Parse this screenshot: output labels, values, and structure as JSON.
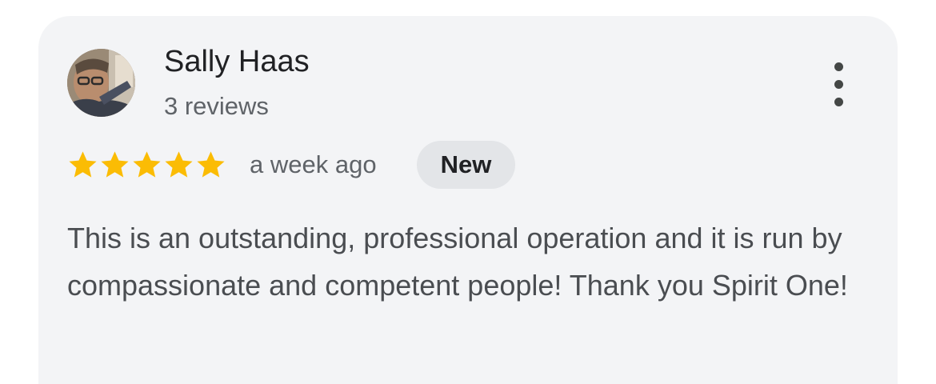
{
  "review": {
    "author_name": "Sally Haas",
    "author_reviews": "3 reviews",
    "rating": 5,
    "rating_max": 5,
    "time_ago": "a week ago",
    "badge": "New",
    "text": "This is an outstanding, professional operation and it is run by compassionate and competent people! Thank you Spirit One!"
  },
  "icons": {
    "avatar": "avatar-photo",
    "star": "star-icon",
    "menu": "more-vert-icon"
  },
  "colors": {
    "card_background": "#f3f4f6",
    "star": "#fbbc04",
    "badge_background": "#e3e5e8",
    "primary_text": "#202124",
    "secondary_text": "#5f6368"
  }
}
